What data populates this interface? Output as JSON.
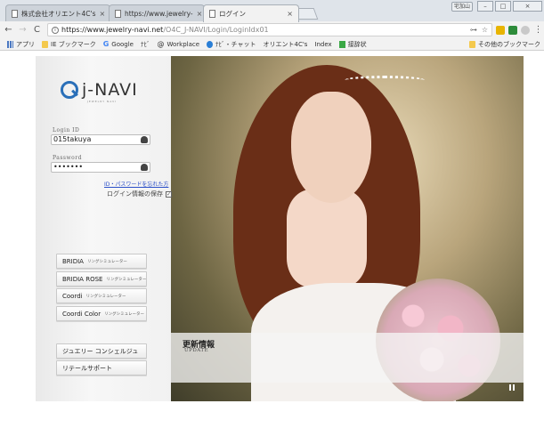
{
  "browser": {
    "tabs": [
      {
        "title": "株式会社オリエント4C's"
      },
      {
        "title": "https://www.jewelry-"
      },
      {
        "title": "ログイン"
      }
    ],
    "user_label": "宅加山",
    "url_host": "https://www.jewelry-navi.net",
    "url_path": "/O4C_J-NAVI/Login/LoginIdx01"
  },
  "bookmarks": {
    "items": [
      {
        "label": "アプリ",
        "icon": "apps-grid-icon"
      },
      {
        "label": "IE ブックマーク",
        "icon": "folder-icon"
      },
      {
        "label": "Google",
        "icon": "google-icon"
      },
      {
        "label": "ﾅﾋﾞ",
        "icon": "page-icon"
      },
      {
        "label": "Workplace",
        "icon": "workplace-icon"
      },
      {
        "label": "ﾅﾋﾞ・チャット",
        "icon": "chat-icon"
      },
      {
        "label": "オリエント4C's",
        "icon": "page-icon"
      },
      {
        "label": "Index",
        "icon": "page-icon"
      },
      {
        "label": "接辞状",
        "icon": "green-icon"
      }
    ],
    "other": "その他のブックマーク"
  },
  "login": {
    "logo_text": "j-NAVI",
    "logo_sub": "JEWELRY NAVI",
    "id_label": "Login ID",
    "id_value": "015takuya",
    "password_label": "Password",
    "password_value": "•••••••",
    "forgot_link": "ID・パスワードを忘れた方",
    "remember_label": "ログイン情報の保存",
    "remember_checked": "✓"
  },
  "simulators": [
    {
      "name": "BRIDIA",
      "sub": "リングシミュレーター"
    },
    {
      "name": "BRIDIA ROSE",
      "sub": "リングシミュレーター"
    },
    {
      "name": "Coordi",
      "sub": "リングシミュレーター"
    },
    {
      "name": "Coordi Color",
      "sub": "リングシミュレーター"
    }
  ],
  "support": [
    {
      "name": "ジュエリー コンシェルジュ"
    },
    {
      "name": "リテールサポート"
    }
  ],
  "news": {
    "title": "更新情報",
    "title_en": "UPDATE"
  }
}
